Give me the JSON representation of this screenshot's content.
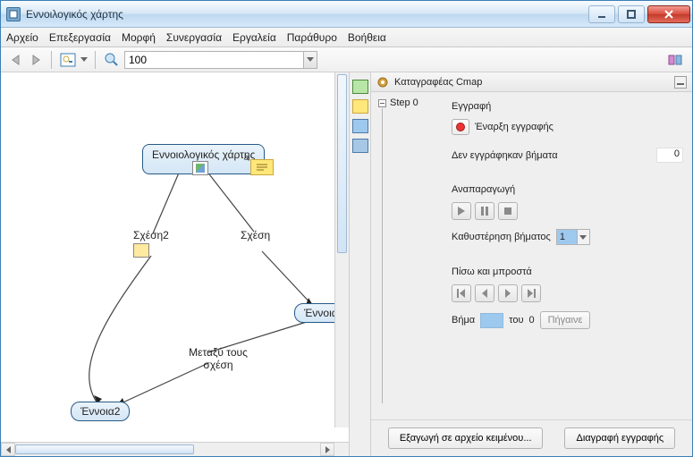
{
  "window": {
    "title": "Εννοιλογικός χάρτης"
  },
  "menubar": [
    "Αρχείο",
    "Επεξεργασία",
    "Μορφή",
    "Συνεργασία",
    "Εργαλεία",
    "Παράθυρο",
    "Βοήθεια"
  ],
  "toolbar": {
    "zoom_value": "100"
  },
  "cmap": {
    "root": "Εννοιολογικός χάρτης",
    "link1": "Σχέση2",
    "link2": "Σχέση",
    "link3": "Μεταξύ τους σχέση",
    "node1": "Έννοια",
    "node2": "Έννοια2"
  },
  "recorder": {
    "panel_title": "Καταγραφέας Cmap",
    "tree_root": "Step 0",
    "section_record": "Εγγραφή",
    "start_recording": "Έναρξη εγγραφής",
    "no_steps_label": "Δεν εγγράφηκαν βήματα",
    "no_steps_value": "0",
    "section_playback": "Αναπαραγωγή",
    "step_delay_label": "Καθυστέρηση βήματος",
    "step_delay_value": "1",
    "section_nav": "Πίσω και μπροστά",
    "step_label_a": "Βήμα",
    "step_label_b": "του",
    "step_total": "0",
    "go": "Πήγαινε",
    "export": "Εξαγωγή σε αρχείο κειμένου...",
    "delete": "Διαγραφή εγγραφής"
  }
}
